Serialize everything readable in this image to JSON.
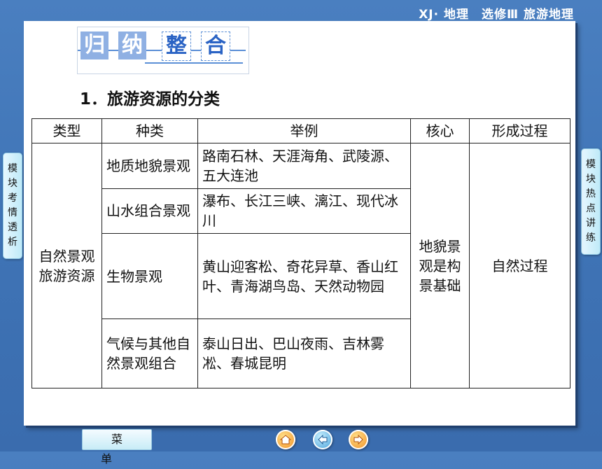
{
  "header": {
    "course_title": "XJ· 地理　选修Ⅲ 旅游地理"
  },
  "banner": {
    "chars": [
      "归",
      "纳",
      "整",
      "合"
    ]
  },
  "section": {
    "heading": "1．旅游资源的分类"
  },
  "table": {
    "headers": [
      "类型",
      "种类",
      "举例",
      "核心",
      "形成过程"
    ],
    "type_cell": "自然景观旅游资源",
    "rows": [
      {
        "kind": "地质地貌景观",
        "example": "路南石林、天涯海角、武陵源、五大连池"
      },
      {
        "kind": "山水组合景观",
        "example": "瀑布、长江三峡、漓江、现代冰川"
      },
      {
        "kind": "生物景观",
        "example": "黄山迎客松、奇花异草、香山红叶、青海湖鸟岛、天然动物园"
      },
      {
        "kind": "气候与其他自然景观组合",
        "example": "泰山日出、巴山夜雨、吉林雾凇、春城昆明"
      }
    ],
    "core_cell": "地貌景观是构景基础",
    "process_cell": "自然过程"
  },
  "left_tab": {
    "label": [
      "模",
      "块",
      "考",
      "情",
      "透",
      "析"
    ]
  },
  "right_tab": {
    "label": [
      "模",
      "块",
      "热",
      "点",
      "讲",
      "练"
    ]
  },
  "footer": {
    "menu_label": "菜单",
    "nav_icons": [
      "home-icon",
      "back-icon",
      "forward-icon"
    ]
  },
  "colors": {
    "background": "#4a7fc0",
    "accent": "#2a63c4",
    "banner_light": "#8fb0e3"
  }
}
